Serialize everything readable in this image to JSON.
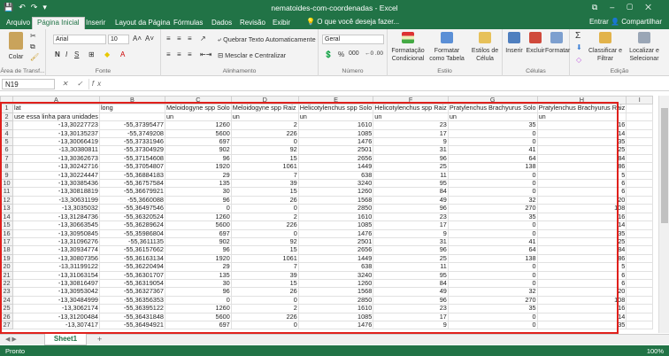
{
  "window": {
    "title": "nematoides-com-coordenadas - Excel",
    "controls": [
      "–",
      "▢",
      "✕"
    ],
    "qat": [
      "💾",
      "↶",
      "↷",
      "▾"
    ],
    "restore": "⧉"
  },
  "tabs": [
    "Arquivo",
    "Página Inicial",
    "Inserir",
    "Layout da Página",
    "Fórmulas",
    "Dados",
    "Revisão",
    "Exibir"
  ],
  "tell_me": "O que você deseja fazer...",
  "account": {
    "signin": "Entrar",
    "share": "Compartilhar"
  },
  "ribbon": {
    "clipboard": {
      "paste": "Colar",
      "label": "Área de Transf..."
    },
    "font": {
      "name": "Arial",
      "size": "10",
      "label": "Fonte",
      "bold": "N",
      "italic": "I",
      "underline": "S"
    },
    "alignment": {
      "wrap": "Quebrar Texto Automaticamente",
      "merge": "Mesclar e Centralizar",
      "label": "Alinhamento"
    },
    "number": {
      "format": "Geral",
      "label": "Número",
      "percent": "%",
      "thousands": "000"
    },
    "styles": {
      "conditional": "Formatação Condicional",
      "table": "Formatar como Tabela",
      "cell": "Estilos de Célula",
      "label": "Estilo"
    },
    "cells": {
      "insert": "Inserir",
      "delete": "Excluir",
      "format": "Formatar",
      "label": "Células"
    },
    "editing": {
      "sort": "Classificar e Filtrar",
      "find": "Localizar e Selecionar",
      "label": "Edição"
    }
  },
  "formula_bar": {
    "name_box": "N19",
    "fx": "✕ ✓ fx",
    "value": ""
  },
  "columns": [
    "A",
    "B",
    "C",
    "D",
    "E",
    "F",
    "G",
    "H",
    "I"
  ],
  "rows": [
    [
      "1",
      "lat",
      "long",
      "Meloidogyne spp Solo",
      "Meloidogyne spp Raiz",
      "Helicotylenchus spp Solo",
      "Helicotylenchus spp Raiz",
      "Pratylenchus Brachyurus Solo",
      "Pratylenchus Brachyurus Raiz",
      ""
    ],
    [
      "2",
      "use essa linha para unidades",
      "",
      "un",
      "un",
      "un",
      "un",
      "un",
      "un",
      ""
    ],
    [
      "3",
      "-13,30227723",
      "-55,37395477",
      "1260",
      "2",
      "1610",
      "23",
      "35",
      "16",
      ""
    ],
    [
      "4",
      "-13,30135237",
      "-55,3749208",
      "5600",
      "226",
      "1085",
      "17",
      "0",
      "14",
      ""
    ],
    [
      "5",
      "-13,30066419",
      "-55,37331946",
      "697",
      "0",
      "1476",
      "9",
      "0",
      "35",
      ""
    ],
    [
      "6",
      "-13,30380811",
      "-55,37304929",
      "902",
      "92",
      "2501",
      "31",
      "41",
      "25",
      ""
    ],
    [
      "7",
      "-13,30362673",
      "-55,37154608",
      "96",
      "15",
      "2656",
      "96",
      "64",
      "84",
      ""
    ],
    [
      "8",
      "-13,30242716",
      "-55,37054807",
      "1920",
      "1061",
      "1449",
      "25",
      "138",
      "86",
      ""
    ],
    [
      "9",
      "-13,30224447",
      "-55,36884183",
      "29",
      "7",
      "638",
      "11",
      "0",
      "5",
      ""
    ],
    [
      "10",
      "-13,30385436",
      "-55,36757584",
      "135",
      "39",
      "3240",
      "95",
      "0",
      "6",
      ""
    ],
    [
      "11",
      "-13,30818819",
      "-55,36679921",
      "30",
      "15",
      "1260",
      "84",
      "0",
      "6",
      ""
    ],
    [
      "12",
      "-13,30631199",
      "-55,3660088",
      "96",
      "26",
      "1568",
      "49",
      "32",
      "20",
      ""
    ],
    [
      "13",
      "-13,3035032",
      "-55,36497546",
      "0",
      "0",
      "2850",
      "96",
      "270",
      "108",
      ""
    ],
    [
      "14",
      "-13,31284736",
      "-55,36320524",
      "1260",
      "2",
      "1610",
      "23",
      "35",
      "16",
      ""
    ],
    [
      "15",
      "-13,30663545",
      "-55,36289624",
      "5600",
      "226",
      "1085",
      "17",
      "0",
      "14",
      ""
    ],
    [
      "16",
      "-13,30950845",
      "-55,35986804",
      "697",
      "0",
      "1476",
      "9",
      "0",
      "35",
      ""
    ],
    [
      "17",
      "-13,31096276",
      "-55,3611135",
      "902",
      "92",
      "2501",
      "31",
      "41",
      "25",
      ""
    ],
    [
      "18",
      "-13,30934774",
      "-55,36157662",
      "96",
      "15",
      "2656",
      "96",
      "64",
      "84",
      ""
    ],
    [
      "19",
      "-13,30807356",
      "-55,36163134",
      "1920",
      "1061",
      "1449",
      "25",
      "138",
      "86",
      ""
    ],
    [
      "20",
      "-13,31199122",
      "-55,36220494",
      "29",
      "7",
      "638",
      "11",
      "0",
      "5",
      ""
    ],
    [
      "21",
      "-13,31063154",
      "-55,36301707",
      "135",
      "39",
      "3240",
      "95",
      "0",
      "6",
      ""
    ],
    [
      "22",
      "-13,30816497",
      "-55,36319054",
      "30",
      "15",
      "1260",
      "84",
      "0",
      "6",
      ""
    ],
    [
      "23",
      "-13,30953042",
      "-55,36327367",
      "96",
      "26",
      "1568",
      "49",
      "32",
      "20",
      ""
    ],
    [
      "24",
      "-13,30484999",
      "-55,36356353",
      "0",
      "0",
      "2850",
      "96",
      "270",
      "108",
      ""
    ],
    [
      "25",
      "-13,3062174",
      "-55,36395122",
      "1260",
      "2",
      "1610",
      "23",
      "35",
      "16",
      ""
    ],
    [
      "26",
      "-13,31200484",
      "-55,36431848",
      "5600",
      "226",
      "1085",
      "17",
      "0",
      "14",
      ""
    ],
    [
      "27",
      "-13,307417",
      "-55,36494921",
      "697",
      "0",
      "1476",
      "9",
      "0",
      "35",
      ""
    ]
  ],
  "sheet": {
    "name": "Sheet1",
    "add": "+"
  },
  "status": {
    "left": "Pronto",
    "zoom": "100%"
  }
}
